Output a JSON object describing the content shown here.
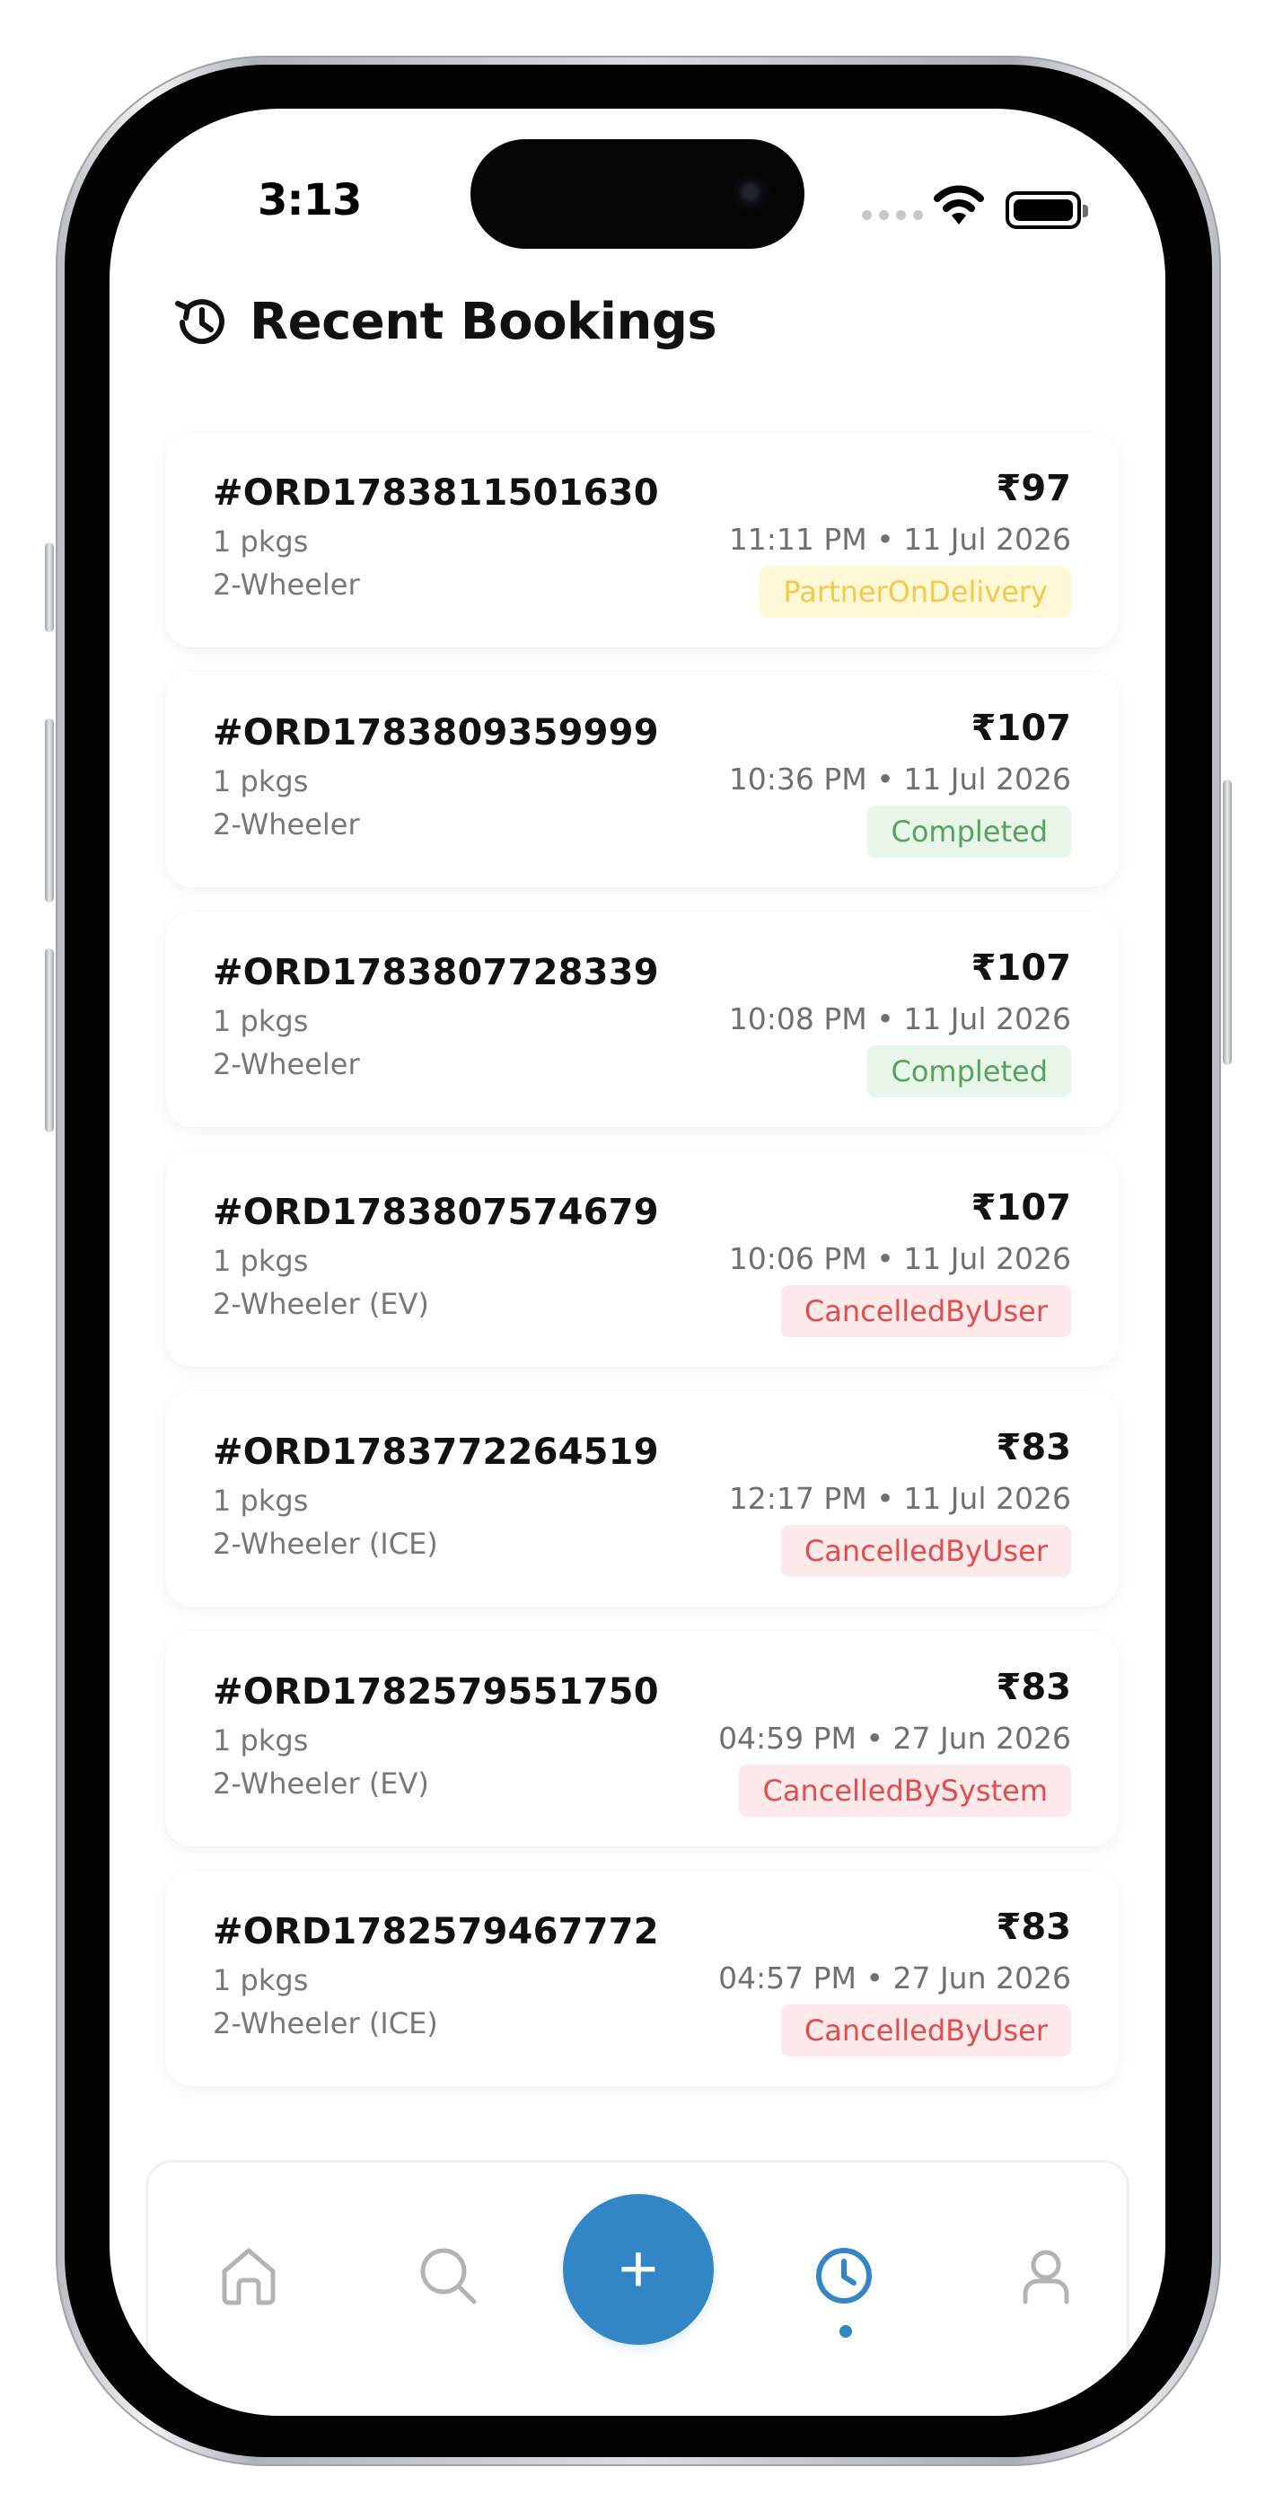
{
  "status_bar": {
    "time": "3:13",
    "icons": [
      "cellular-dots-icon",
      "wifi-icon",
      "battery-icon"
    ]
  },
  "header": {
    "icon": "history-icon",
    "title": "Recent Bookings"
  },
  "bookings": [
    {
      "order_id": "#ORD1783811501630",
      "packages": "1 pkgs",
      "vehicle": "2-Wheeler",
      "price": "₹97",
      "datetime": "11:11 PM • 11 Jul 2026",
      "status": "PartnerOnDelivery",
      "status_color": "#F2C94C"
    },
    {
      "order_id": "#ORD1783809359999",
      "packages": "1 pkgs",
      "vehicle": "2-Wheeler",
      "price": "₹107",
      "datetime": "10:36 PM • 11 Jul 2026",
      "status": "Completed",
      "status_color": "#56A35C"
    },
    {
      "order_id": "#ORD1783807728339",
      "packages": "1 pkgs",
      "vehicle": "2-Wheeler",
      "price": "₹107",
      "datetime": "10:08 PM • 11 Jul 2026",
      "status": "Completed",
      "status_color": "#56A35C"
    },
    {
      "order_id": "#ORD1783807574679",
      "packages": "1 pkgs",
      "vehicle": "2-Wheeler (EV)",
      "price": "₹107",
      "datetime": "10:06 PM • 11 Jul 2026",
      "status": "CancelledByUser",
      "status_color": "#E14D4D"
    },
    {
      "order_id": "#ORD1783772264519",
      "packages": "1 pkgs",
      "vehicle": "2-Wheeler (ICE)",
      "price": "₹83",
      "datetime": "12:17 PM • 11 Jul 2026",
      "status": "CancelledByUser",
      "status_color": "#E14D4D"
    },
    {
      "order_id": "#ORD1782579551750",
      "packages": "1 pkgs",
      "vehicle": "2-Wheeler (EV)",
      "price": "₹83",
      "datetime": "04:59 PM • 27 Jun 2026",
      "status": "CancelledBySystem",
      "status_color": "#E14D4D"
    },
    {
      "order_id": "#ORD1782579467772",
      "packages": "1 pkgs",
      "vehicle": "2-Wheeler (ICE)",
      "price": "₹83",
      "datetime": "04:57 PM • 27 Jun 2026",
      "status": "CancelledByUser",
      "status_color": "#E14D4D"
    }
  ],
  "bottom_nav": {
    "items": [
      {
        "icon": "home-icon",
        "active": false
      },
      {
        "icon": "search-icon",
        "active": false
      },
      {
        "icon": "add-icon",
        "active": false,
        "label": "+"
      },
      {
        "icon": "clock-icon",
        "active": true
      },
      {
        "icon": "profile-icon",
        "active": false
      }
    ],
    "accent_color": "#3286C6",
    "inactive_color": "#B3B3B3"
  }
}
